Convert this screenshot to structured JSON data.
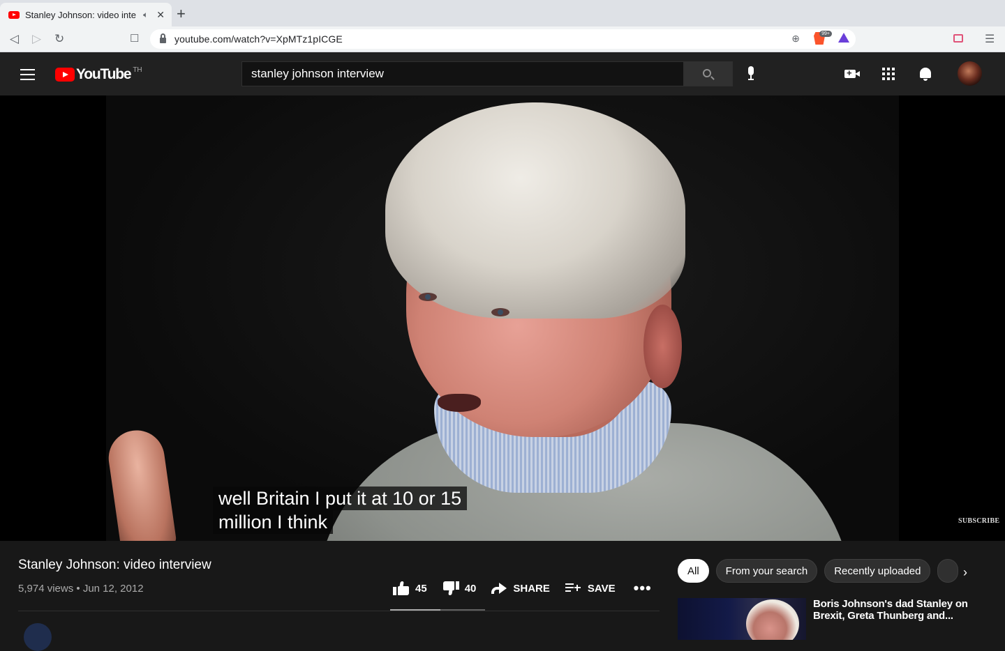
{
  "browser": {
    "tab_title": "Stanley Johnson: video inter",
    "url": "youtube.com/watch?v=XpMTz1pICGE",
    "brave_badge": "99+"
  },
  "masthead": {
    "logo_text": "YouTube",
    "region": "TH",
    "search_query": "stanley johnson interview"
  },
  "player": {
    "caption_lines": [
      "well Britain I put it at 10 or 15",
      "million I think"
    ],
    "watermark": "SUBSCRIBE"
  },
  "video": {
    "title": "Stanley Johnson: video interview",
    "views": "5,974 views",
    "date": "Jun 12, 2012",
    "likes": "45",
    "dislikes": "40",
    "like_ratio": 0.53,
    "share_label": "SHARE",
    "save_label": "SAVE"
  },
  "chips": [
    "All",
    "From your search",
    "Recently uploaded"
  ],
  "recommendations": [
    {
      "title": "Boris Johnson's dad Stanley on Brexit, Greta Thunberg and..."
    }
  ]
}
